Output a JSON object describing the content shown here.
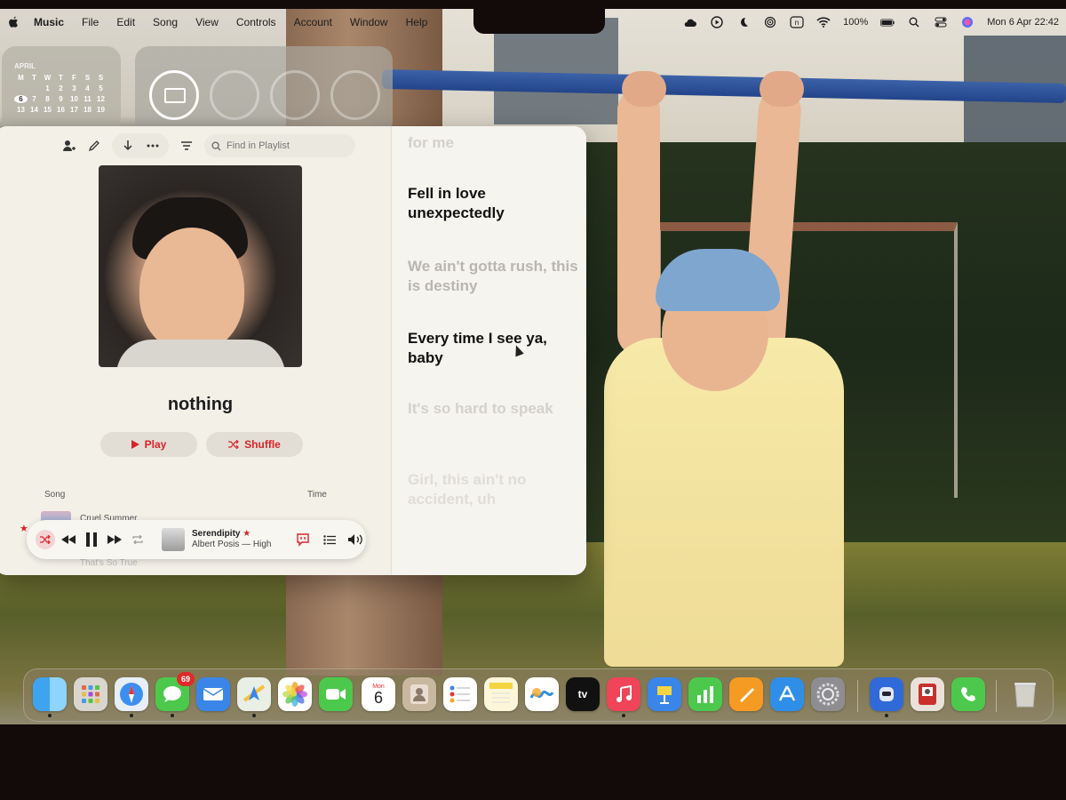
{
  "menubar": {
    "app": "Music",
    "items": [
      "File",
      "Edit",
      "Song",
      "View",
      "Controls",
      "Account",
      "Window",
      "Help"
    ],
    "battery": "100%",
    "datetime": "Mon 6 Apr  22:42"
  },
  "calendar_widget": {
    "month": "APRIL",
    "weekdays": [
      "M",
      "T",
      "W",
      "T",
      "F",
      "S",
      "S"
    ],
    "days": [
      "",
      "",
      "1",
      "2",
      "3",
      "4",
      "5",
      "6",
      "7",
      "8",
      "9",
      "10",
      "11",
      "12",
      "13",
      "14",
      "15",
      "16",
      "17",
      "18",
      "19"
    ],
    "today": "6"
  },
  "toolbar": {
    "search_placeholder": "Find in Playlist"
  },
  "playlist": {
    "title": "nothing",
    "play_label": "Play",
    "shuffle_label": "Shuffle",
    "col_song": "Song",
    "col_time": "Time",
    "row1_title": "Cruel Summer",
    "row2_title": "That's So True"
  },
  "now_playing": {
    "title": "Serendipity",
    "artist": "Albert Posis — High"
  },
  "lyrics": {
    "line0": "for me",
    "line1": "Fell in love unexpectedly",
    "line2": "We ain't gotta rush, this is destiny",
    "line3": "Every time I see ya, baby",
    "line4": "It's so hard to speak",
    "line5": "Girl, this ain't no accident, uh"
  },
  "dock": {
    "calendar_month": "Mon",
    "calendar_day": "6",
    "messages_badge": "69",
    "tv_label": "tv"
  },
  "colors": {
    "accent": "#d8232a"
  }
}
